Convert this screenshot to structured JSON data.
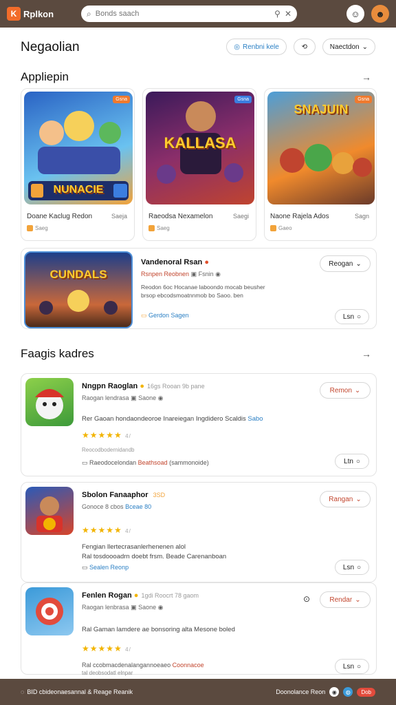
{
  "topbar": {
    "logo_mark": "K",
    "logo_text": "Rplkon",
    "search_placeholder": "Bonds saach",
    "search_icon": "search-icon",
    "close_icon": "close-icon"
  },
  "header": {
    "title": "Negaolian",
    "action1": "Renbni kele",
    "action3": "Naectdon"
  },
  "section1": {
    "title": "Appliepin",
    "arrow": "→"
  },
  "featured": [
    {
      "art_title": "NUNACIE",
      "badge": "Gsna",
      "name": "Doane Kaclug Redon",
      "meta": "Saeja",
      "sub": "Saeg",
      "colors": [
        "#2a63c4",
        "#6ac2f0"
      ]
    },
    {
      "art_title": "KALLASA",
      "badge": "Gsna",
      "name": "Raeodsa Nexamelon",
      "meta": "Saegi",
      "sub": "Saeg",
      "colors": [
        "#3a1a5a",
        "#c0442f"
      ]
    },
    {
      "art_title": "SNAJUIN",
      "badge": "Gsna",
      "name": "Naone Rajela Ados",
      "meta": "Sagn",
      "sub": "Gaeo",
      "colors": [
        "#f08a2c",
        "#4c9ed8"
      ]
    }
  ],
  "wide": {
    "art_title": "CUNDALS",
    "title": "Vandenoral Rsan",
    "line2_red": "Rsnpen Reobnen",
    "line2_grey": "Fsnin",
    "desc": "Reodon 6oc Hocanae laboondo mocab beusher brsop ebcodsmoatnnmob bo Saoo. ben",
    "link": "Gerdon Sagen",
    "dropdown": "Reogan",
    "small_btn": "Lsn"
  },
  "section2": {
    "title": "Faagis kadres",
    "arrow": "→"
  },
  "list": [
    {
      "title": "Nngpn Raoglan",
      "tag": "16gs Rooan 9b pane",
      "line2": "Raogan lendrasa",
      "line2b": "Saone",
      "desc": "Rer Gaoan hondaondeoroe Inareiegan Ingdidero Scaldis",
      "desc_link": "Sabo",
      "stars": "★★★★★",
      "rating": "4/",
      "small": "Reocodbodernidandb",
      "foot": "Raeodocelondan",
      "foot_red": "Beathsoad",
      "foot_end": "(sammonoide)",
      "dropdown": "Remon",
      "small_btn": "Ltn"
    },
    {
      "title": "Sbolon Fanaaphor",
      "tag": "3SD",
      "line2": "Gonoce 8 cbos",
      "line2b": "Bceae 80",
      "desc": "Fengian llertecrasanlerhenenen alol",
      "desc2": "Ral tosdoooadrn doebt frsm. Beade Carenanboan",
      "stars": "★★★★★",
      "rating": "4/",
      "foot_link": "Sealen Reonp",
      "dropdown": "Rangan",
      "small_btn": "Lsn"
    },
    {
      "title": "Fenlen Rogan",
      "tag": "1gdi Roocrt 78 gaom",
      "line2": "Raogan lenbrasa",
      "line2b": "Saone",
      "desc": "Ral Gaman lamdere ae bonsoring alta Mesone boled",
      "stars": "★★★★★",
      "rating": "4/",
      "foot": "Ral ccobmacdenalangannoeaeo",
      "foot_red": "Coonnacoe",
      "foot2": "tal deobsodatl elnpar",
      "dropdown": "Rendar",
      "small_btn": "Lsn"
    }
  ],
  "bottombar": {
    "left": "BID cbideonaesannal & Reage Reanik",
    "right": "Doonolance Reon",
    "pill": "Dob"
  }
}
